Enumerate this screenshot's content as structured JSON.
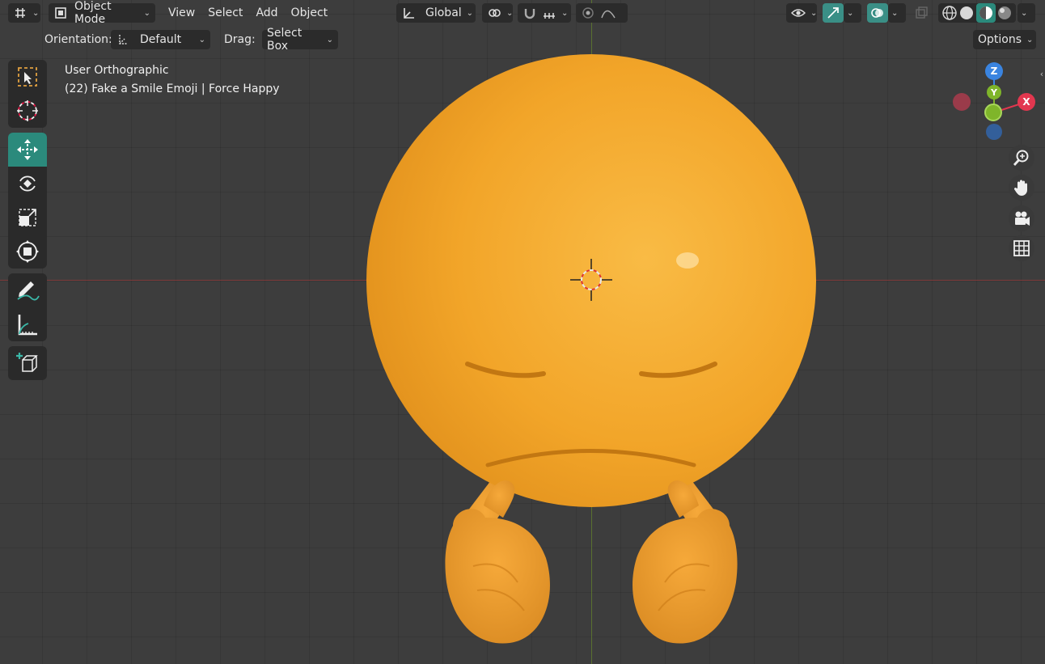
{
  "header": {
    "mode": "Object Mode",
    "menus": [
      "View",
      "Select",
      "Add",
      "Object"
    ],
    "orientation_global": "Global"
  },
  "tool_settings": {
    "orientation_label": "Orientation:",
    "orientation_value": "Default",
    "drag_label": "Drag:",
    "drag_value": "Select Box",
    "options_label": "Options"
  },
  "viewport": {
    "view_name": "User Orthographic",
    "object_info": "(22) Fake a Smile Emoji | Force Happy"
  },
  "gizmo": {
    "z": "Z",
    "y": "Y",
    "x": "X"
  },
  "colors": {
    "accent": "#2b8a7c",
    "axis_x": "#e2374f",
    "axis_y": "#7fb52a",
    "axis_z": "#3a84e0",
    "emoji": "#f4a52a"
  },
  "toolbar_icons": [
    "select-box-icon",
    "cursor-icon",
    "move-icon",
    "rotate-icon",
    "scale-icon",
    "transform-icon",
    "annotate-icon",
    "measure-icon",
    "add-cube-icon"
  ],
  "nav_icons": [
    "zoom-icon",
    "hand-pan-icon",
    "camera-icon",
    "grid-icon"
  ]
}
